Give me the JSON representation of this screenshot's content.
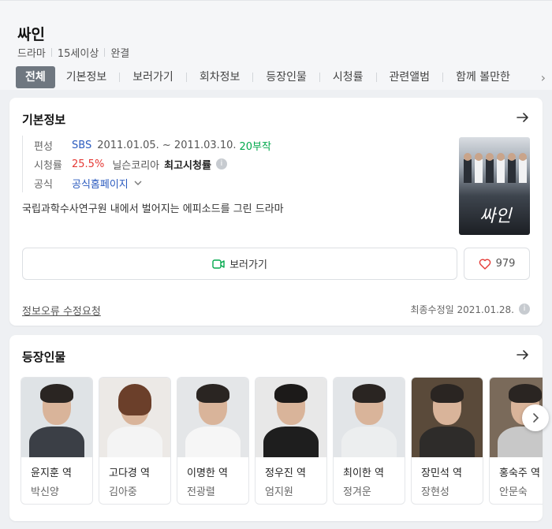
{
  "header": {
    "title": "싸인",
    "meta": [
      "드라마",
      "15세이상",
      "완결"
    ],
    "tabs": [
      "전체",
      "기본정보",
      "보러가기",
      "회차정보",
      "등장인물",
      "시청률",
      "관련앨범",
      "함께 볼만한"
    ]
  },
  "basic_info": {
    "title": "기본정보",
    "rows": {
      "broadcast_label": "편성",
      "channel": "SBS",
      "period": "2011.01.05. ~ 2011.03.10.",
      "episodes": "20부작",
      "rating_label": "시청률",
      "rating_value": "25.5%",
      "rating_source": "닐슨코리아",
      "rating_note": "최고시청률",
      "official_label": "공식",
      "official_link": "공식홈페이지"
    },
    "description": "국립과학수사연구원 내에서 벌어지는 에피소드를 그린 드라마",
    "poster_title": "싸인",
    "watch_label": "보러가기",
    "like_count": "979",
    "report_link": "정보오류 수정요청",
    "updated": "최종수정일 2021.01.28."
  },
  "cast_section": {
    "title": "등장인물",
    "people": [
      {
        "role": "윤지훈 역",
        "actor": "박신양"
      },
      {
        "role": "고다경 역",
        "actor": "김아중"
      },
      {
        "role": "이명한 역",
        "actor": "전광렬"
      },
      {
        "role": "정우진 역",
        "actor": "엄지원"
      },
      {
        "role": "최이한 역",
        "actor": "정겨운"
      },
      {
        "role": "장민석 역",
        "actor": "장현성"
      },
      {
        "role": "홍숙주 역",
        "actor": "안문숙"
      }
    ]
  },
  "colors": {
    "accent_blue": "#2b5bbf",
    "rating_red": "#e53935",
    "episodes_green": "#03a94d",
    "active_tab": "#6f7780"
  }
}
